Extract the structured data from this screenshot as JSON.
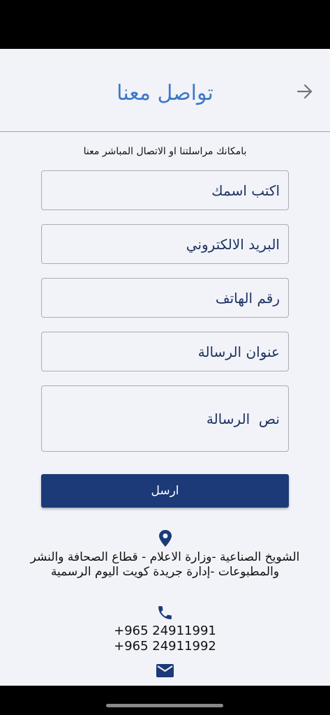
{
  "header": {
    "title": "تواصل معنا"
  },
  "subtitle": "بامكانك مراسلتنا او الاتصال المباشر معنا",
  "form": {
    "name_placeholder": "اكتب اسمك",
    "email_placeholder": "البريد الالكتروني",
    "phone_placeholder": "رقم الهاتف",
    "subject_placeholder": "عنوان الرسالة",
    "message_placeholder": "نص  الرسالة",
    "send_label": "ارسل"
  },
  "contact": {
    "address": "الشويخ الصناعية -وزارة الاعلام - قطاع الصحافة والنشر والمطبوعات -إدارة جريدة كويت اليوم الرسمية",
    "phones": [
      "+965 24911991",
      "+965 24911992"
    ]
  },
  "colors": {
    "title": "#3e78c8",
    "button": "#1c3a78",
    "field_text": "#1e3262",
    "icon": "#1c3a78"
  },
  "icons": {
    "back": "arrow-right-icon",
    "location": "location-pin-icon",
    "phone": "phone-icon",
    "email": "mail-icon"
  }
}
